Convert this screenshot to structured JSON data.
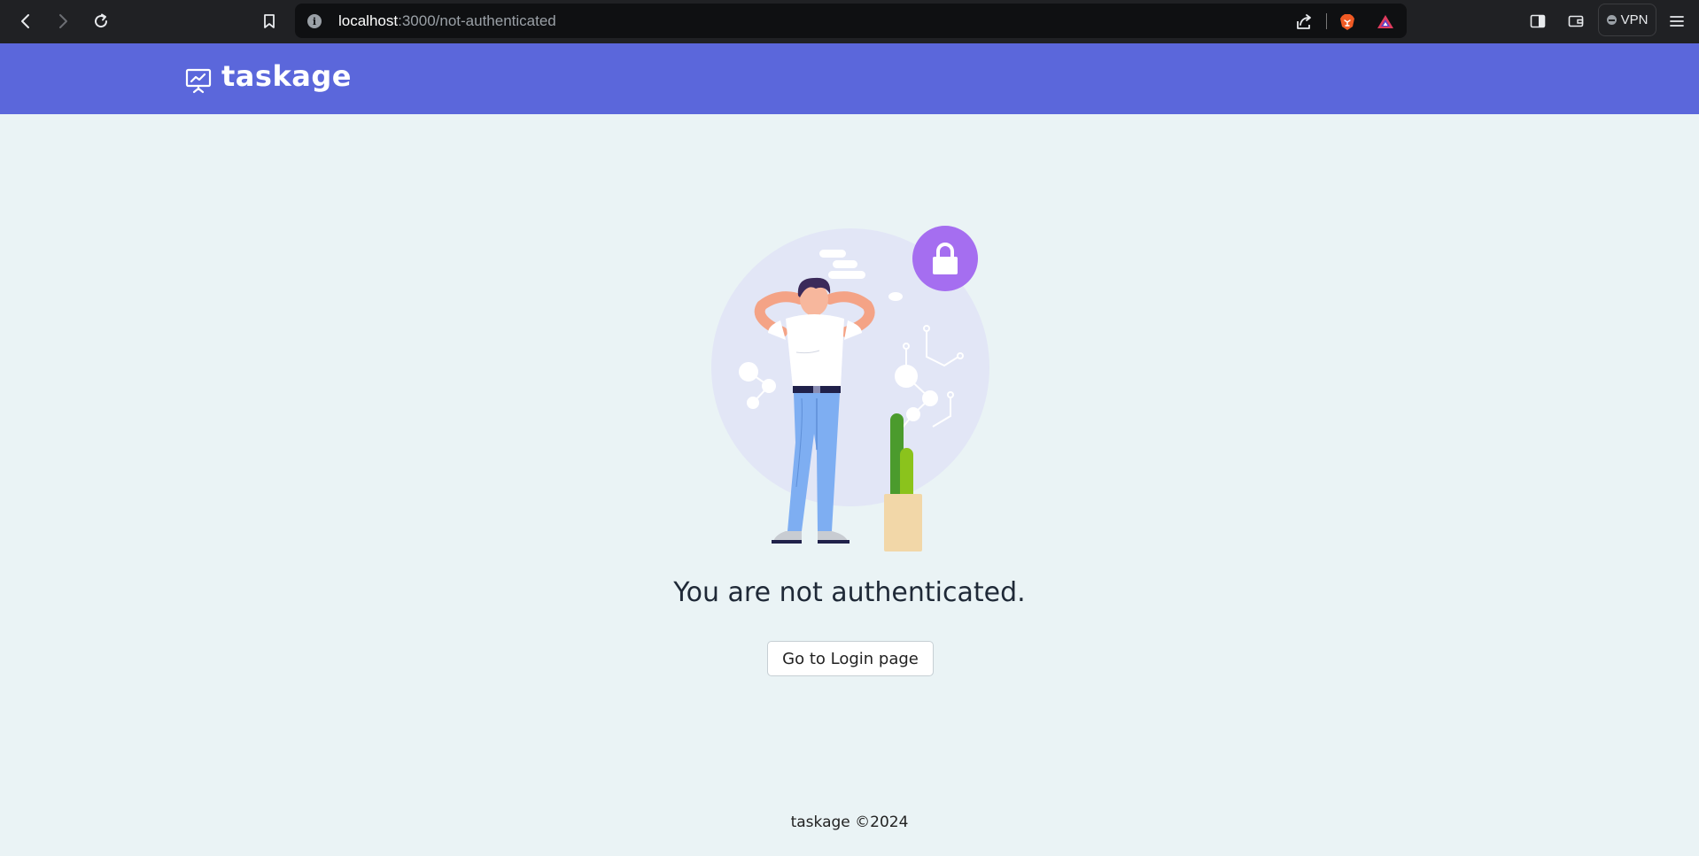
{
  "browser": {
    "url_host": "localhost",
    "url_path": ":3000/not-authenticated",
    "vpn_label": "VPN"
  },
  "header": {
    "logo_text": "taskage",
    "brand_color": "#5b67db"
  },
  "main": {
    "message": "You are not authenticated.",
    "login_button_label": "Go to Login page"
  },
  "footer": {
    "text": "taskage ©2024"
  },
  "icons": {
    "back": "arrow-left-icon",
    "forward": "arrow-right-icon",
    "reload": "reload-icon",
    "bookmark": "bookmark-icon",
    "share": "share-icon",
    "brave": "brave-lion-icon",
    "rewards": "rewards-triangle-icon",
    "sidebar": "sidebar-icon",
    "wallet": "wallet-icon",
    "menu": "hamburger-menu-icon",
    "logo": "presentation-chart-icon",
    "lock": "lock-icon"
  }
}
